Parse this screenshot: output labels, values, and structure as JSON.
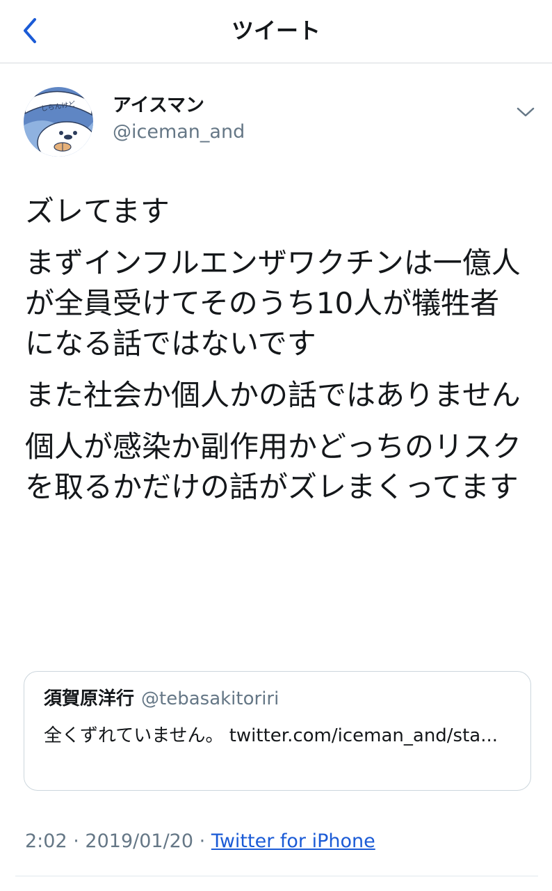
{
  "header": {
    "title": "ツイート",
    "back_icon": "chevron-left-icon"
  },
  "tweet": {
    "author_name": "アイスマン",
    "author_handle": "@iceman_and",
    "avatar_badge": "しらんけど",
    "menu_icon": "chevron-down-icon",
    "paragraphs": [
      "ズレてます",
      "まずインフルエンザワクチンは一億人が全員受けてそのうち10人が犠牲者になる話ではないです",
      "また社会か個人かの話ではありません",
      "個人が感染か副作用かどっちのリスクを取るかだけの話がズレまくってます"
    ],
    "time": "2:02",
    "separator": "·",
    "date": "2019/01/20",
    "source": "Twitter for iPhone"
  },
  "quote": {
    "name": "須賀原洋行",
    "handle": "@tebasakitoriri",
    "text": "全くずれていません。 twitter.com/iceman_and/sta..."
  },
  "colors": {
    "accent": "#1b5bd6",
    "text_primary": "#14171a",
    "text_secondary": "#657786",
    "border": "#ccd6dd"
  }
}
